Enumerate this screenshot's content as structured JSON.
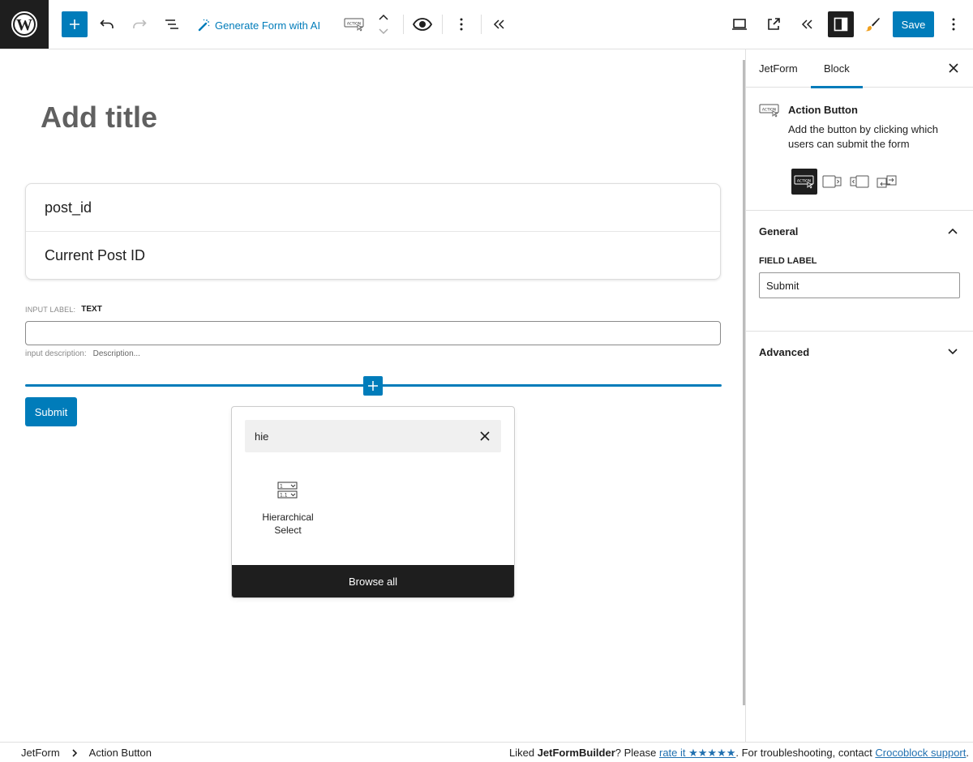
{
  "toolbar": {
    "generate_ai_label": "Generate Form with AI",
    "save_label": "Save",
    "icons": [
      "wordpress-logo",
      "add-block",
      "undo",
      "redo",
      "document-overview",
      "magic-wand",
      "action-button-block",
      "move-up",
      "move-down",
      "preview-eye",
      "more-options",
      "collapse-left",
      "desktop-view",
      "external-preview",
      "collapse-left",
      "settings-panel",
      "styles-brush",
      "more-vertical"
    ]
  },
  "canvas": {
    "title_placeholder": "Add title",
    "hidden_field": {
      "name": "post_id",
      "value": "Current Post ID"
    },
    "text_field": {
      "label_key": "INPUT LABEL:",
      "label_value": "TEXT",
      "value": "",
      "description_key": "input description:",
      "description_placeholder": "Description..."
    },
    "submit_label": "Submit"
  },
  "inserter": {
    "search_value": "hie",
    "results": [
      {
        "label": "Hierarchical Select",
        "icon": "hierarchical-select-icon"
      }
    ],
    "browse_all_label": "Browse all"
  },
  "sidebar": {
    "tabs": [
      {
        "label": "JetForm",
        "active": false
      },
      {
        "label": "Block",
        "active": true
      }
    ],
    "block": {
      "title": "Action Button",
      "description": "Add the button by clicking which users can submit the form",
      "variations": [
        "action-submit",
        "action-next-page",
        "action-prev-page",
        "action-change-render-state"
      ]
    },
    "general": {
      "title": "General",
      "expanded": true,
      "field_label_caption": "FIELD LABEL",
      "field_label_value": "Submit"
    },
    "advanced": {
      "title": "Advanced",
      "expanded": false
    }
  },
  "footer": {
    "breadcrumbs": [
      "JetForm",
      "Action Button"
    ],
    "credit": {
      "prefix": "Liked ",
      "brand": "JetFormBuilder",
      "mid": "? Please ",
      "rate_link": "rate it ★★★★★",
      "after_rate": ". For troubleshooting, contact ",
      "support_link": "Crocoblock support",
      "suffix": "."
    }
  },
  "colors": {
    "accent": "#007cba",
    "dark": "#1e1e1e",
    "link": "#2271b1"
  }
}
